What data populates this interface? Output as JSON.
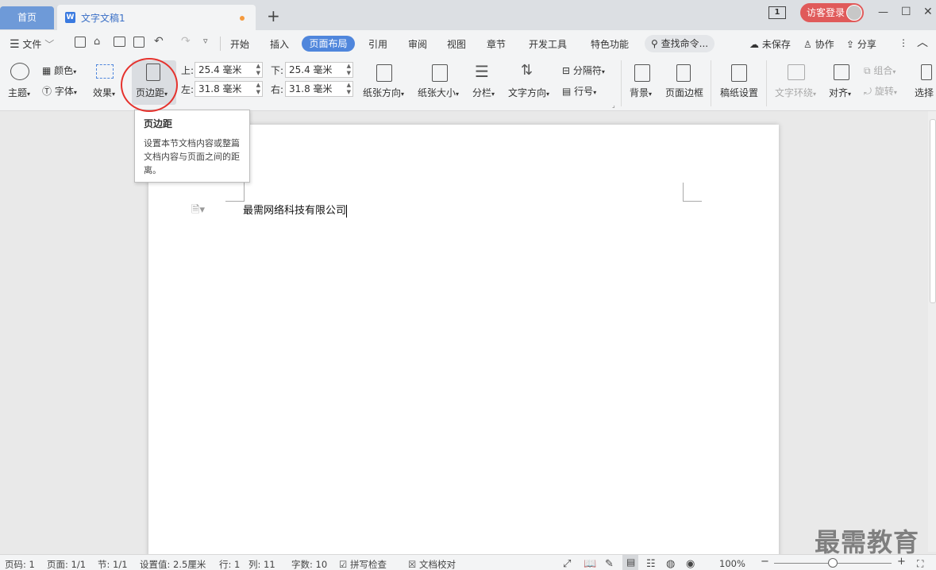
{
  "titlebar": {
    "home_tab": "首页",
    "doc_tab": "文字文稿1",
    "add_tab": "+",
    "login": "访客登录",
    "minimize": "—",
    "maximize": "☐",
    "close": "✕",
    "page_indicator": "1"
  },
  "menubar": {
    "file": "文件",
    "items": [
      "开始",
      "插入",
      "页面布局",
      "引用",
      "审阅",
      "视图",
      "章节",
      "开发工具",
      "特色功能"
    ],
    "active": "页面布局",
    "search": "查找命令...",
    "unsaved": "未保存",
    "collab": "协作",
    "share": "分享"
  },
  "ribbon": {
    "theme": "主题",
    "color": "颜色",
    "font": "字体",
    "effect": "效果",
    "margins": "页边距",
    "top_label": "上:",
    "top_value": "25.4 毫米",
    "bottom_label": "下:",
    "bottom_value": "25.4 毫米",
    "left_label": "左:",
    "left_value": "31.8 毫米",
    "right_label": "右:",
    "right_value": "31.8 毫米",
    "orientation": "纸张方向",
    "size": "纸张大小",
    "columns": "分栏",
    "text_dir": "文字方向",
    "separator": "分隔符",
    "line_no": "行号",
    "background": "背景",
    "page_border": "页面边框",
    "draft_setup": "稿纸设置",
    "wrap": "文字环绕",
    "align": "对齐",
    "group": "组合",
    "rotate": "旋转",
    "select": "选择"
  },
  "tooltip": {
    "title": "页边距",
    "body": "设置本节文档内容或整篇文档内容与页面之间的距离。"
  },
  "document": {
    "text": "最需网络科技有限公司"
  },
  "statusbar": {
    "page_code": "页码: 1",
    "page": "页面: 1/1",
    "section": "节: 1/1",
    "setting": "设置值: 2.5厘米",
    "row": "行: 1",
    "col": "列: 11",
    "word_count": "字数: 10",
    "spell_check": "拼写检查",
    "doc_check": "文档校对",
    "zoom": "100%"
  },
  "watermark": "最需教育",
  "colors": {
    "accent": "#4f86dc",
    "home_tab": "#6e9ad8",
    "login": "#e05a5a",
    "highlight": "#e5322d"
  }
}
